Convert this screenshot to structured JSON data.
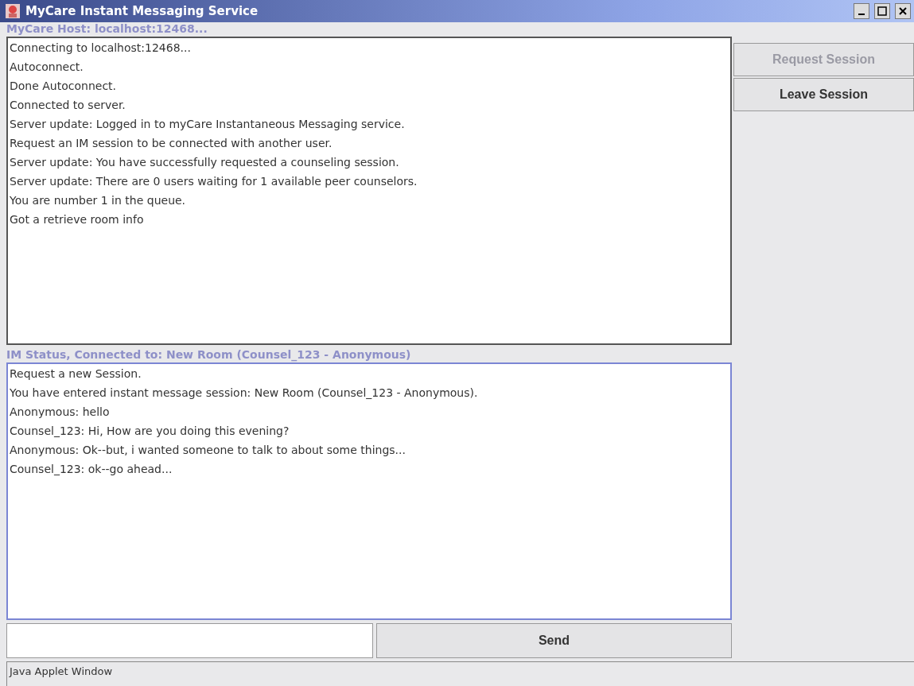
{
  "window": {
    "title": "MyCare Instant Messaging Service"
  },
  "host_label": "MyCare Host: localhost:12468...",
  "server_log": [
    "Connecting to localhost:12468...",
    "Autoconnect.",
    "Done Autoconnect.",
    "Connected to server.",
    "Server update: Logged in to myCare Instantaneous Messaging service.",
    "Request an IM session to be connected with another user.",
    "Server update: You have successfully requested a counseling session.",
    "Server update: There are 0 users waiting for 1 available peer counselors.",
    "You are number 1 in the queue.",
    "Got a retrieve room info"
  ],
  "session_buttons": [
    {
      "label": "Request Session",
      "disabled": true
    },
    {
      "label": "Leave Session",
      "disabled": false
    }
  ],
  "im_status_label": "IM Status, Connected to: New Room (Counsel_123 - Anonymous)",
  "chat_log": [
    "Request a new Session.",
    "You have entered instant message session: New Room (Counsel_123 - Anonymous).",
    "Anonymous: hello",
    "Counsel_123: Hi, How are you doing this evening?",
    "Anonymous: Ok--but, i wanted someone to talk to about some things...",
    "Counsel_123: ok--go ahead..."
  ],
  "send_button": "Send",
  "status_bar": "Java Applet Window"
}
